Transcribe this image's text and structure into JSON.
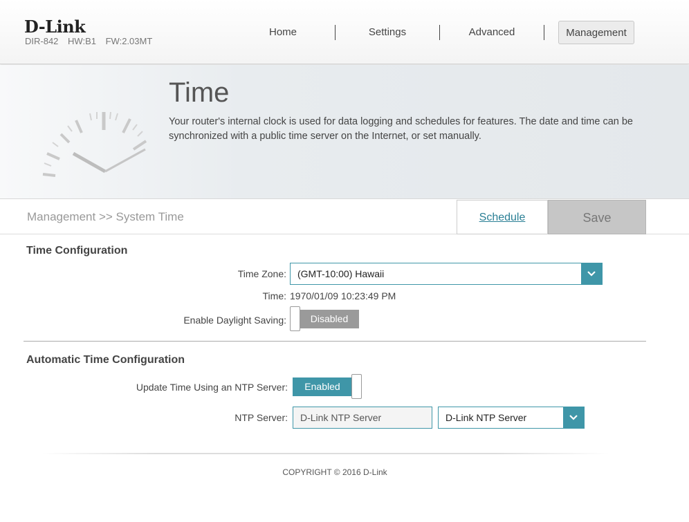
{
  "header": {
    "logo": "D-Link",
    "model": "DIR-842",
    "hw": "HW:B1",
    "fw": "FW:2.03MT",
    "nav": [
      {
        "label": "Home"
      },
      {
        "label": "Settings"
      },
      {
        "label": "Advanced"
      },
      {
        "label": "Management",
        "active": true
      }
    ]
  },
  "hero": {
    "title": "Time",
    "description": "Your router's internal clock is used for data logging and schedules for features. The date and time can be synchronized with a public time server on the Internet, or set manually."
  },
  "breadcrumb": "Management >> System Time",
  "actions": {
    "schedule_label": "Schedule",
    "save_label": "Save"
  },
  "time_config": {
    "title": "Time Configuration",
    "timezone_label": "Time Zone:",
    "timezone_value": "(GMT-10:00) Hawaii",
    "time_label": "Time:",
    "time_value": "1970/01/09 10:23:49 PM",
    "daylight_label": "Enable Daylight Saving:",
    "daylight_state": "Disabled"
  },
  "auto_config": {
    "title": "Automatic Time Configuration",
    "ntp_update_label": "Update Time Using an NTP Server:",
    "ntp_update_state": "Enabled",
    "ntp_server_label": "NTP Server:",
    "ntp_server_input": "D-Link NTP Server",
    "ntp_server_select": "D-Link NTP Server"
  },
  "footer": {
    "copyright": "COPYRIGHT © 2016 D-Link"
  },
  "colors": {
    "accent": "#3f96a8",
    "toggle_off": "#9a9a9a",
    "save_disabled": "#c6c6c6"
  },
  "icons": [
    "clock-icon",
    "chevron-down-icon"
  ]
}
